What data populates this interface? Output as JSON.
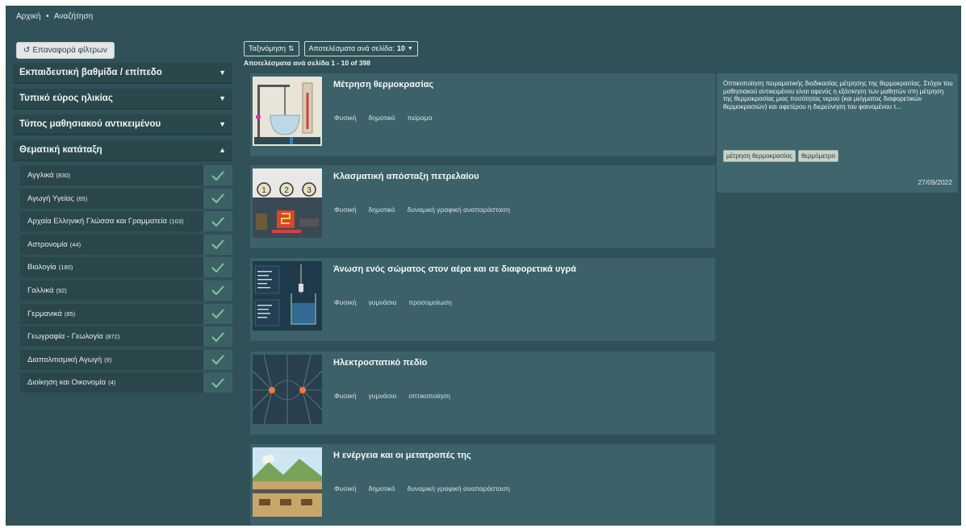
{
  "breadcrumb": {
    "home": "Αρχική",
    "sep": "•",
    "current": "Αναζήτηση"
  },
  "reset_label": "Επαναφορά φίλτρων",
  "filters": [
    {
      "label": "Εκπαιδευτική βαθμίδα / επίπεδο",
      "caret": "▼"
    },
    {
      "label": "Τυπικό εύρος ηλικίας",
      "caret": "▼"
    },
    {
      "label": "Τύπος μαθησιακού αντικειμένου",
      "caret": "▼"
    },
    {
      "label": "Θεματική κατάταξη",
      "caret": "▲"
    }
  ],
  "subjects": [
    {
      "name": "Αγγλικά",
      "count": "(830)"
    },
    {
      "name": "Αγωγή Υγείας",
      "count": "(65)"
    },
    {
      "name": "Αρχαία Ελληνική Γλώσσα και Γραμματεία",
      "count": "(103)"
    },
    {
      "name": "Αστρονομία",
      "count": "(44)"
    },
    {
      "name": "Βιολογία",
      "count": "(180)"
    },
    {
      "name": "Γαλλικά",
      "count": "(92)"
    },
    {
      "name": "Γερμανικά",
      "count": "(85)"
    },
    {
      "name": "Γεωγραφία - Γεωλογία",
      "count": "(872)"
    },
    {
      "name": "Διαπολιτισμική Αγωγή",
      "count": "(9)"
    },
    {
      "name": "Διοίκηση και Οικονομία",
      "count": "(4)"
    }
  ],
  "toolbar": {
    "sort_label": "Ταξινόμηση",
    "per_page_label": "Αποτελέσματα ανά σελίδα:",
    "per_page_value": "10"
  },
  "results_count": "Αποτελέσματα ανά σελίδα   1 - 10 of 398",
  "results": [
    {
      "title": "Μέτρηση θερμοκρασίας",
      "tags": [
        "Φυσική",
        "δημοτικό",
        "πείραμα"
      ]
    },
    {
      "title": "Κλασματική απόσταξη πετρελαίου",
      "tags": [
        "Φυσική",
        "δημοτικό",
        "δυναμική γραφική αναπαράσταση"
      ]
    },
    {
      "title": "Άνωση ενός σώματος στον αέρα και σε διαφορετικά υγρά",
      "tags": [
        "Φυσική",
        "γυμνάσιο",
        "προσομοίωση"
      ]
    },
    {
      "title": "Ηλεκτροστατικό πεδίο",
      "tags": [
        "Φυσική",
        "γυμνάσιο",
        "οπτικοποίηση"
      ]
    },
    {
      "title": "Η ενέργεια και οι μετατροπές της",
      "tags": [
        "Φυσική",
        "δημοτικό",
        "δυναμική γραφική αναπαράσταση"
      ]
    }
  ],
  "preview": {
    "description": "Οπτικοποίηση πειραματικής διαδικασίας μέτρησης της θερμοκρασίας. Στόχοι του μαθησιακού αντικειμένου είναι αφενός η εξάσκηση των μαθητών στη μέτρηση της θερμοκρασίας μιας ποσότητας νερού (και μείγματος διαφορετικών θερμοκρασιών) και αφετέρου η διερεύνηση του φαινομένου τ...",
    "keywords": [
      "μέτρηση θερμοκρασίας",
      "θερμόμετρο"
    ],
    "date": "27/09/2022"
  },
  "thumb_labels": [
    "1",
    "2",
    "3"
  ],
  "colors": {
    "background": "#2f5157",
    "card": "#3c6168",
    "check_bg": "#3b6166",
    "check": "#7fc79a"
  }
}
